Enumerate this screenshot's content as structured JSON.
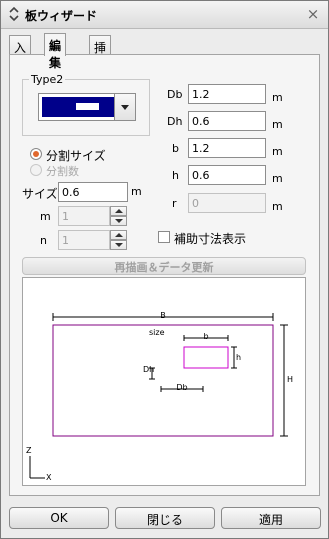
{
  "window": {
    "title": "板ウィザード",
    "close_icon": "×"
  },
  "tabs": [
    {
      "label": "入力"
    },
    {
      "label": "編集",
      "active": true
    },
    {
      "label": "挿入"
    }
  ],
  "type_group": {
    "title": "Type2",
    "swatch_color": "#00008a"
  },
  "division": {
    "option_size_label": "分割サイズ",
    "option_count_label": "分割数",
    "size_label": "サイズ",
    "size_value": "0.6",
    "size_unit": "m",
    "m_label": "m",
    "m_value": "1",
    "n_label": "n",
    "n_value": "1"
  },
  "params": [
    {
      "label": "Db",
      "value": "1.2",
      "unit": "m"
    },
    {
      "label": "Dh",
      "value": "0.6",
      "unit": "m"
    },
    {
      "label": "b",
      "value": "1.2",
      "unit": "m"
    },
    {
      "label": "h",
      "value": "0.6",
      "unit": "m"
    },
    {
      "label": "r",
      "value": "0",
      "unit": "m"
    }
  ],
  "aux_dims_label": "補助寸法表示",
  "redraw_label": "再描画＆データ更新",
  "preview": {
    "B": "B",
    "H": "H",
    "size": "size",
    "b": "b",
    "h": "h",
    "Dh": "Dh",
    "Db": "Db",
    "axis_z": "Z",
    "axis_x": "X",
    "plate_color": "#800080",
    "opening_color": "#cc00cc"
  },
  "buttons": {
    "ok": "OK",
    "close": "閉じる",
    "apply": "適用"
  }
}
